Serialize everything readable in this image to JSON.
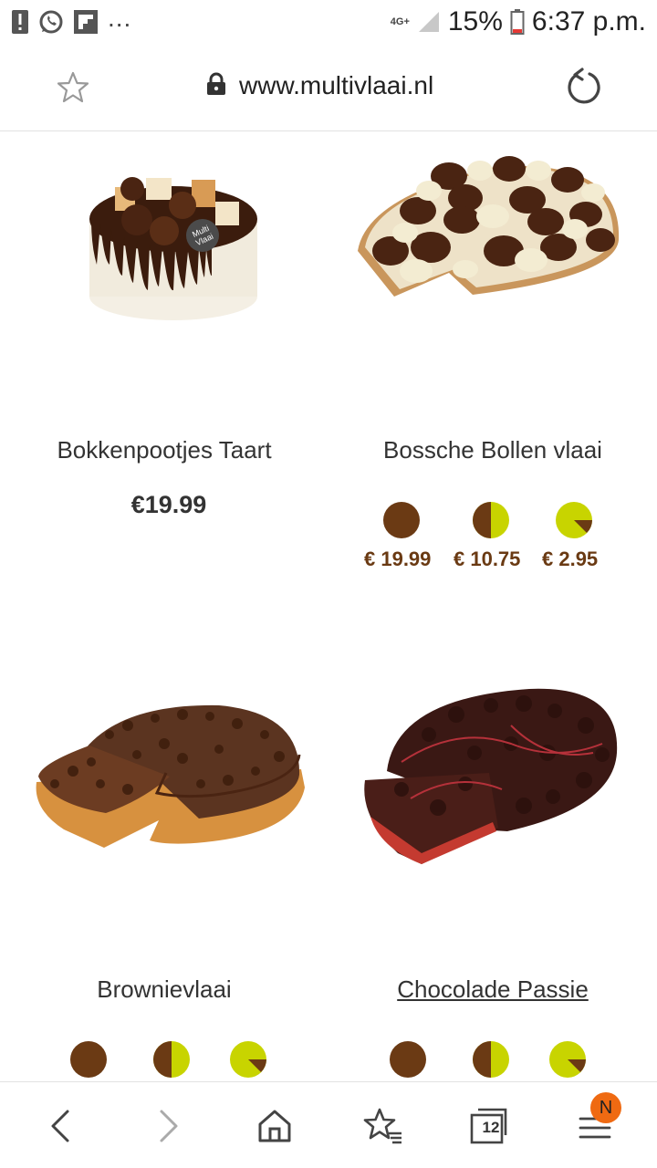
{
  "status_bar": {
    "overflow_dots": "...",
    "network": "4G+",
    "battery": "15%",
    "time": "6:37 p.m."
  },
  "browser": {
    "url": "www.multivlaai.nl"
  },
  "products": [
    {
      "name": "Bokkenpootjes Taart",
      "price": "€19.99"
    },
    {
      "name": "Bossche Bollen vlaai",
      "prices": [
        "€ 19.99",
        "€ 10.75",
        "€ 2.95"
      ]
    },
    {
      "name": "Brownievlaai"
    },
    {
      "name": "Chocolade Passie"
    }
  ],
  "bottom_nav": {
    "tabs_count": "12",
    "notification_badge": "N"
  },
  "colors": {
    "size_brown": "#6b3a14",
    "size_lime": "#c8d400",
    "price_brown": "#6a3a13",
    "badge_orange": "#ef6a12"
  },
  "icons": [
    "alert-icon",
    "whatsapp-icon",
    "flipboard-icon",
    "signal-icon",
    "battery-icon",
    "star-icon",
    "lock-icon",
    "reload-icon",
    "back-icon",
    "forward-icon",
    "home-icon",
    "bookmarks-icon",
    "tabs-icon",
    "menu-icon"
  ]
}
